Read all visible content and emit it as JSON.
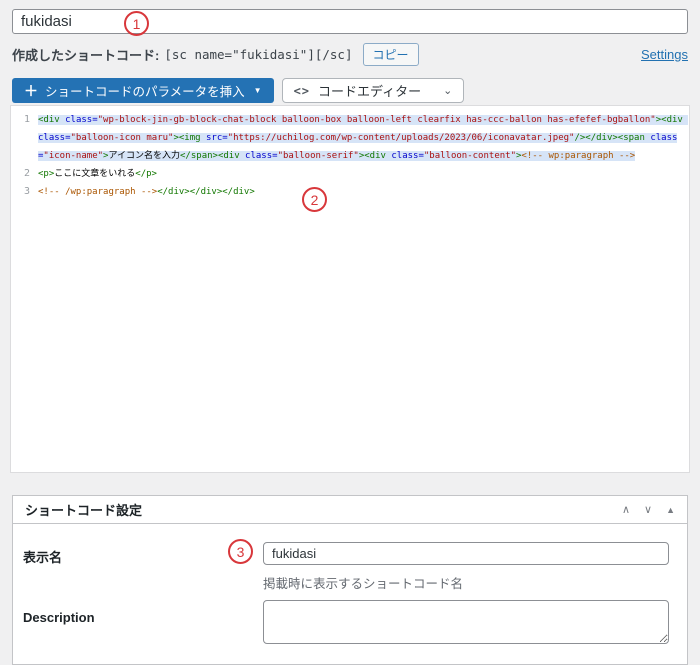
{
  "page": {
    "bg_color": "#f0f0f1",
    "accent_color": "#2271b1"
  },
  "name_input": {
    "value": "fukidasi"
  },
  "shortcode_bar": {
    "label": "作成したショートコード:",
    "code": "[sc name=\"fukidasi\"][/sc]",
    "copy_button_label": "コピー",
    "settings_link_label": "Settings"
  },
  "toolbar": {
    "plus_icon": "＋",
    "insert_param_label": "ショートコードのパラメータを挿入",
    "caret_icon": "▼",
    "code_icon": "<>",
    "editor_mode_label": "コードエディター",
    "chevron_icon": "⌄"
  },
  "editor": {
    "syntax_colors": {
      "tag": "#117700",
      "attribute": "#0000cc",
      "string": "#aa1111",
      "comment": "#aa5500",
      "selection_bg": "#d6e4f7"
    },
    "lines": [
      {
        "no": "1",
        "selected": true,
        "tokens": [
          {
            "c": "tag",
            "s": "<div"
          },
          {
            "c": "plain",
            "s": " "
          },
          {
            "c": "attr",
            "s": "class="
          },
          {
            "c": "str",
            "s": "\"wp-block-jin-gb-block-chat-block balloon-box balloon-left clearfix has-ccc-ballon has-efefef-bgballon\""
          },
          {
            "c": "tag",
            "s": "><div"
          },
          {
            "c": "plain",
            "s": " "
          },
          {
            "c": "attr",
            "s": "class="
          },
          {
            "c": "str",
            "s": "\"balloon-icon maru\""
          },
          {
            "c": "tag",
            "s": "><img"
          },
          {
            "c": "plain",
            "s": " "
          },
          {
            "c": "attr",
            "s": "src="
          },
          {
            "c": "str",
            "s": "\"https://uchilog.com/wp-content/uploads/2023/06/iconavatar.jpeg\""
          },
          {
            "c": "tag",
            "s": "/></div><span"
          },
          {
            "c": "plain",
            "s": " "
          },
          {
            "c": "attr",
            "s": "class="
          },
          {
            "c": "str",
            "s": "\"icon-name\""
          },
          {
            "c": "tag",
            "s": ">"
          },
          {
            "c": "plain",
            "s": "アイコン名を入力"
          },
          {
            "c": "tag",
            "s": "</span><div"
          },
          {
            "c": "plain",
            "s": " "
          },
          {
            "c": "attr",
            "s": "class="
          },
          {
            "c": "str",
            "s": "\"balloon-serif\""
          },
          {
            "c": "tag",
            "s": "><div"
          },
          {
            "c": "plain",
            "s": " "
          },
          {
            "c": "attr",
            "s": "class="
          },
          {
            "c": "str",
            "s": "\"balloon-content\""
          },
          {
            "c": "tag",
            "s": ">"
          },
          {
            "c": "comment",
            "s": "<!-- wp:paragraph -->"
          }
        ]
      },
      {
        "no": "2",
        "selected": false,
        "tokens": [
          {
            "c": "tag",
            "s": "<p>"
          },
          {
            "c": "plain",
            "s": "ここに文章をいれる"
          },
          {
            "c": "tag",
            "s": "</p>"
          }
        ]
      },
      {
        "no": "3",
        "selected": false,
        "tokens": [
          {
            "c": "comment",
            "s": "<!-- /wp:paragraph -->"
          },
          {
            "c": "tag",
            "s": "</div></div></div>"
          }
        ]
      }
    ]
  },
  "annotations": [
    {
      "n": "1"
    },
    {
      "n": "2"
    },
    {
      "n": "3"
    }
  ],
  "settings_panel": {
    "title": "ショートコード設定",
    "move_up_icon": "∧",
    "move_down_icon": "∨",
    "collapse_icon": "▲",
    "fields": {
      "display_name": {
        "label": "表示名",
        "value": "fukidasi",
        "help": "掲載時に表示するショートコード名"
      },
      "description": {
        "label": "Description",
        "value": ""
      }
    }
  }
}
